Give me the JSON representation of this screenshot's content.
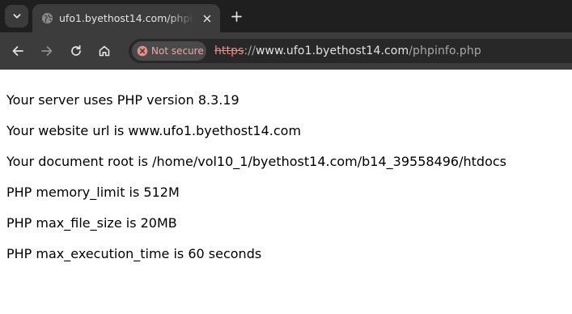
{
  "browser": {
    "tab": {
      "title": "ufo1.byethost14.com/phpinfo.php"
    },
    "toolbar": {
      "security_label": "Not secure",
      "url_scheme": "https",
      "url_separator": "://",
      "url_host": "www.ufo1.byethost14.com",
      "url_path": "/phpinfo.php"
    }
  },
  "page": {
    "lines": [
      "Your server uses PHP version 8.3.19",
      "Your website url is www.ufo1.byethost14.com",
      "Your document root is /home/vol10_1/byethost14.com/b14_39558496/htdocs",
      "PHP memory_limit is 512M",
      "PHP max_file_size is 20MB",
      "PHP max_execution_time is 60 seconds"
    ]
  },
  "icons": {
    "tab_search": "chevron-down-icon",
    "favicon": "globe-icon",
    "tab_close": "close-icon",
    "new_tab": "plus-icon",
    "back": "arrow-left-icon",
    "forward": "arrow-right-icon",
    "reload": "reload-icon",
    "home": "home-icon",
    "security": "warning-icon"
  },
  "colors": {
    "tab_strip_bg": "#1f1f1f",
    "active_tab_bg": "#3c3c3c",
    "omnibox_bg": "#282828",
    "not_secure_red": "#e58e86",
    "page_bg": "#ffffff",
    "page_text": "#000000"
  }
}
